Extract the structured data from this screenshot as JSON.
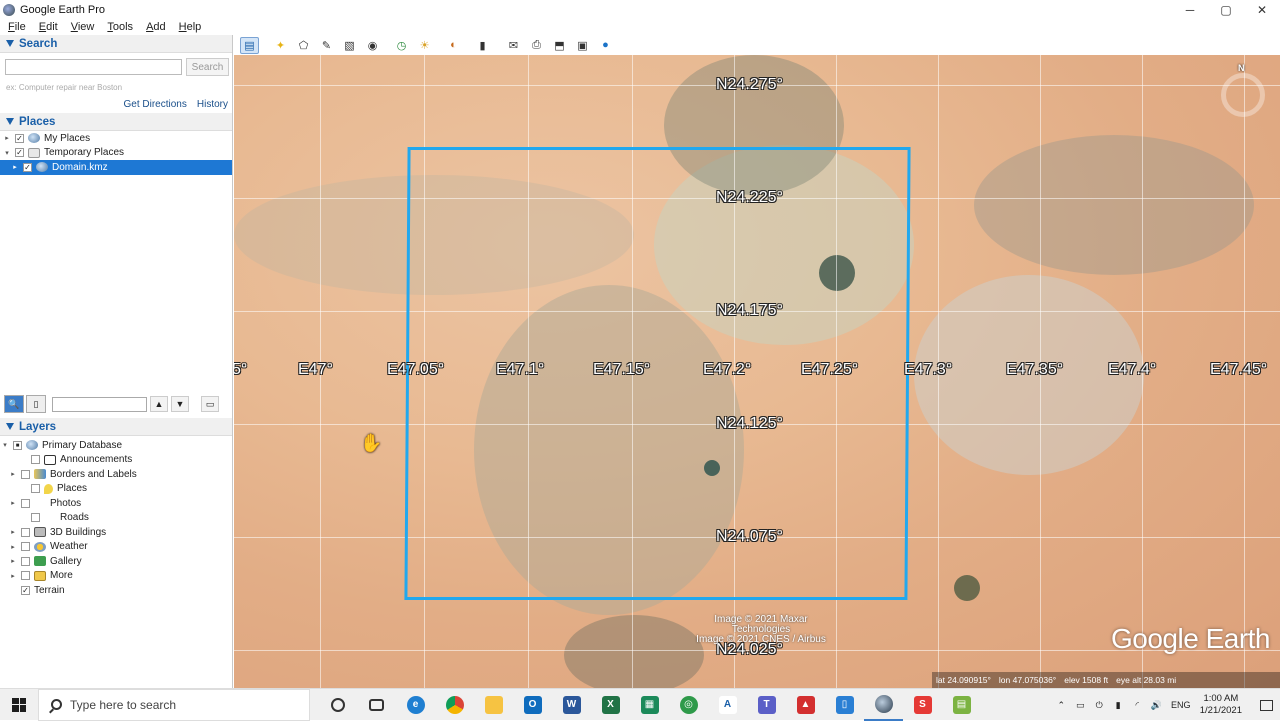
{
  "window": {
    "title": "Google Earth Pro",
    "controls": [
      "─",
      "▢",
      "✕"
    ]
  },
  "menu": [
    "File",
    "Edit",
    "View",
    "Tools",
    "Add",
    "Help"
  ],
  "search": {
    "header": "Search",
    "placeholder": "",
    "button": "Search",
    "hint": "ex: Computer repair near Boston",
    "get_directions": "Get Directions",
    "history": "History"
  },
  "places": {
    "header": "Places",
    "items": [
      {
        "label": "My Places",
        "checked": true,
        "expander": "▸",
        "icon": "globe-icon"
      },
      {
        "label": "Temporary Places",
        "checked": true,
        "expander": "▾",
        "icon": "folder-icon"
      },
      {
        "label": "Domain.kmz",
        "checked": true,
        "expander": "▸",
        "icon": "globe-icon",
        "selected": true
      }
    ]
  },
  "layers": {
    "header": "Layers",
    "items": [
      {
        "label": "Primary Database",
        "checked": "partial",
        "expander": "▾",
        "icon": "globe-icon"
      },
      {
        "label": "Announcements",
        "checked": false,
        "icon": "news-icon"
      },
      {
        "label": "Borders and Labels",
        "checked": false,
        "expander": "▸",
        "icon": "borders-icon"
      },
      {
        "label": "Places",
        "checked": false,
        "icon": "placemark-icon"
      },
      {
        "label": "Photos",
        "checked": false,
        "expander": "▸",
        "icon": "photo-icon"
      },
      {
        "label": "Roads",
        "checked": false,
        "icon": "road-icon"
      },
      {
        "label": "3D Buildings",
        "checked": false,
        "expander": "▸",
        "icon": "building-icon"
      },
      {
        "label": "Weather",
        "checked": false,
        "expander": "▸",
        "icon": "weather-icon"
      },
      {
        "label": "Gallery",
        "checked": false,
        "expander": "▸",
        "icon": "gallery-icon"
      },
      {
        "label": "More",
        "checked": false,
        "expander": "▸",
        "icon": "more-icon"
      },
      {
        "label": "Terrain",
        "checked": true,
        "icon": ""
      }
    ]
  },
  "map": {
    "lat_labels": [
      "N24.275°",
      "N24.225°",
      "N24.175°",
      "N24.125°",
      "N24.075°",
      "N24.025°"
    ],
    "lon_labels": [
      "5°",
      "E47°",
      "E47.05°",
      "E47.1°",
      "E47.15°",
      "E47.2°",
      "E47.25°",
      "E47.3°",
      "E47.35°",
      "E47.4°",
      "E47.45°"
    ],
    "copyright": [
      "Image © 2021 Maxar Technologies",
      "Image © 2021 CNES / Airbus"
    ],
    "logo": "Google Earth",
    "compass_north": "N",
    "status": {
      "lat": "lat  24.090915°",
      "lon": "lon  47.075036°",
      "elev": "elev  1508 ft",
      "eye_alt": "eye alt  28.03 mi"
    },
    "domain_box_color": "#21a8ee"
  },
  "taskbar": {
    "search_placeholder": "Type here to search",
    "language": "ENG",
    "time": "1:00 AM",
    "date": "1/21/2021"
  }
}
